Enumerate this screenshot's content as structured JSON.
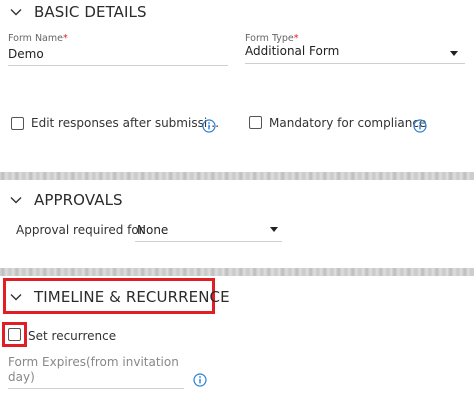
{
  "basic_details": {
    "title": "BASIC DETAILS",
    "form_name_label": "Form Name",
    "form_name_value": "Demo",
    "form_type_label": "Form Type",
    "form_type_value": "Additional Form",
    "required_mark": "*",
    "edit_responses_label": "Edit responses after submissi…",
    "mandatory_label": "Mandatory for compliance"
  },
  "approvals": {
    "title": "APPROVALS",
    "approval_label": "Approval required for",
    "approval_value": "None"
  },
  "timeline": {
    "title": "TIMELINE & RECURRENCE",
    "set_recurrence_label": "Set recurrence",
    "form_expires_label_line1": "Form Expires(from invitation",
    "form_expires_label_line2": "day)"
  },
  "icons": {
    "chevron": "chevron-down-icon",
    "info": "info-icon",
    "caret": "caret-down-icon"
  },
  "colors": {
    "accent_info": "#2a7fd4",
    "highlight_red": "#e01e26",
    "required_red": "#d9222a"
  }
}
